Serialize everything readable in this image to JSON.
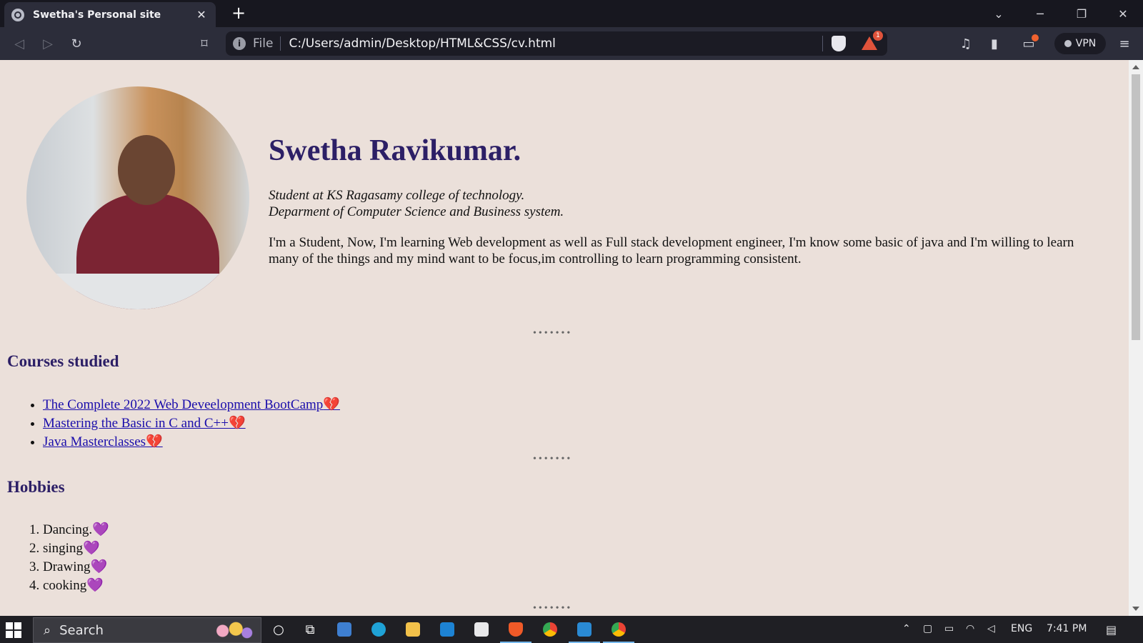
{
  "browser": {
    "tab_title": "Swetha's Personal site",
    "tab_close": "✕",
    "new_tab": "+",
    "scheme_label": "File",
    "url": "C:/Users/admin/Desktop/HTML&CSS/cv.html",
    "rewards_badge": "1",
    "vpn_label": "VPN",
    "window_controls": {
      "list": "⌄",
      "minimize": "─",
      "restore": "❐",
      "close": "✕"
    },
    "nav": {
      "back": "◁",
      "forward": "▷",
      "reload": "↻",
      "bookmark": "⌑"
    }
  },
  "page": {
    "name": "Swetha Ravikumar.",
    "role_line1": "Student at KS Ragasamy college of technology.",
    "role_line2": "Deparment of Computer Science and Business system.",
    "bio": "I'm a Student, Now, I'm learning Web development as well as Full stack development engineer, I'm know some basic of java and I'm willing to learn many of the things and my mind want to be focus,im controlling to learn programming consistent.",
    "divider": "•••••••",
    "courses_heading": "Courses studied",
    "courses": [
      {
        "label": "The Complete 2022 Web Deveelopment BootCamp",
        "emoji": "💔"
      },
      {
        "label": "Mastering the Basic in C and C++",
        "emoji": "💔"
      },
      {
        "label": "Java Masterclasses",
        "emoji": "💔"
      }
    ],
    "hobbies_heading": "Hobbies",
    "hobbies": [
      {
        "label": "Dancing.",
        "emoji": "💜"
      },
      {
        "label": "singing",
        "emoji": "💜"
      },
      {
        "label": "Drawing",
        "emoji": "💜"
      },
      {
        "label": "cooking",
        "emoji": "💜"
      }
    ]
  },
  "taskbar": {
    "search_placeholder": "Search",
    "language": "ENG",
    "time": "7:41 PM"
  }
}
